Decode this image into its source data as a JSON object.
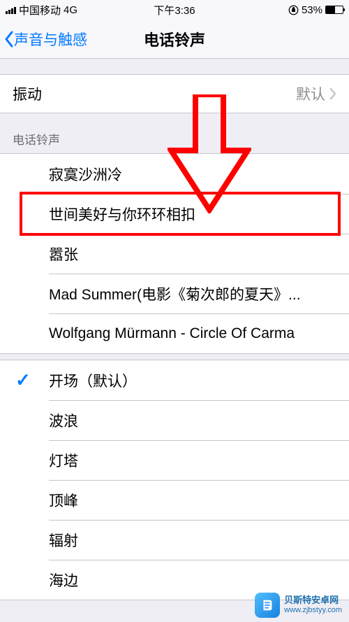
{
  "status": {
    "carrier": "中国移动",
    "network": "4G",
    "time": "下午3:36",
    "battery_pct": "53%"
  },
  "nav": {
    "back_label": "声音与触感",
    "title": "电话铃声"
  },
  "vibration": {
    "label": "振动",
    "value": "默认"
  },
  "section_header": "电话铃声",
  "custom_ringtones": [
    "寂寞沙洲冷",
    "世间美好与你环环相扣",
    "嚣张",
    "Mad Summer(电影《菊次郎的夏天》...",
    "Wolfgang Mürmann - Circle Of Carma"
  ],
  "default_ringtones": [
    "开场（默认）",
    "波浪",
    "灯塔",
    "顶峰",
    "辐射",
    "海边"
  ],
  "selected_default_index": 0,
  "highlighted_custom_index": 1,
  "watermark": {
    "line1": "贝斯特安卓网",
    "line2": "www.zjbstyy.com"
  }
}
